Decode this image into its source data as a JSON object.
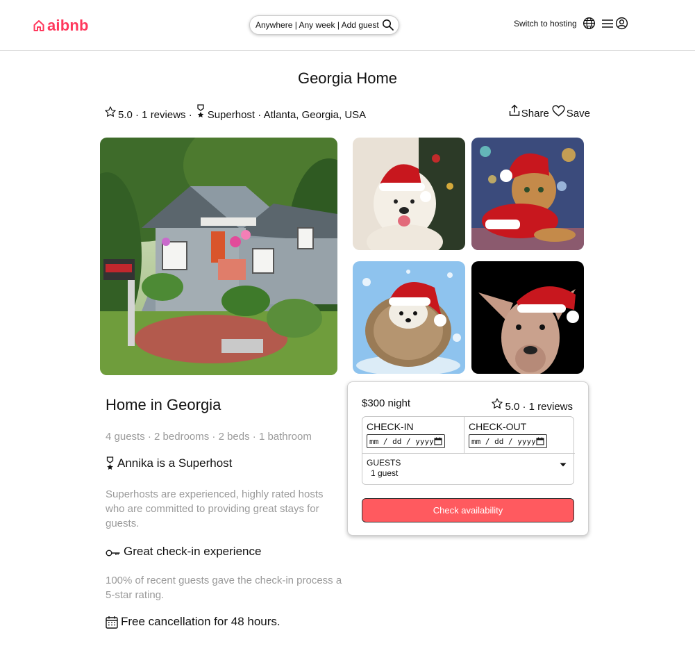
{
  "header": {
    "logo_text": "aibnb",
    "search_text": "Anywhere | Any week | Add guest",
    "switch_label": "Switch to hosting",
    "brand_color": "#ff385c"
  },
  "listing": {
    "title": "Georgia Home",
    "rating_text": "5.0 · 1 reviews ·",
    "superhost_text": "Superhost · Atlanta, Georgia, USA",
    "share_label": "Share",
    "save_label": "Save"
  },
  "details": {
    "home_title": "Home in Georgia",
    "specs": "4 guests · 2 bedrooms · 2 beds · 1 bathroom",
    "features": [
      {
        "icon": "medal-icon",
        "title": "Annika is a Superhost",
        "desc": "Superhosts are experienced, highly rated hosts who are committed to providing great stays for guests."
      },
      {
        "icon": "key-icon",
        "title": "Great check-in experience",
        "desc": "100% of recent guests gave the check-in process a 5-star rating."
      },
      {
        "icon": "calendar-icon",
        "title": "Free cancellation for 48 hours.",
        "desc": ""
      }
    ]
  },
  "booking": {
    "price": "$300 night",
    "rating": "5.0 · 1 reviews",
    "checkin_label": "CHECK-IN",
    "checkout_label": "CHECK-OUT",
    "date_placeholder": "mm / dd / yyyy",
    "guests_label": "GUESTS",
    "guests_value": "1 guest",
    "button_label": "Check availability",
    "button_color": "#ff5a5f"
  }
}
